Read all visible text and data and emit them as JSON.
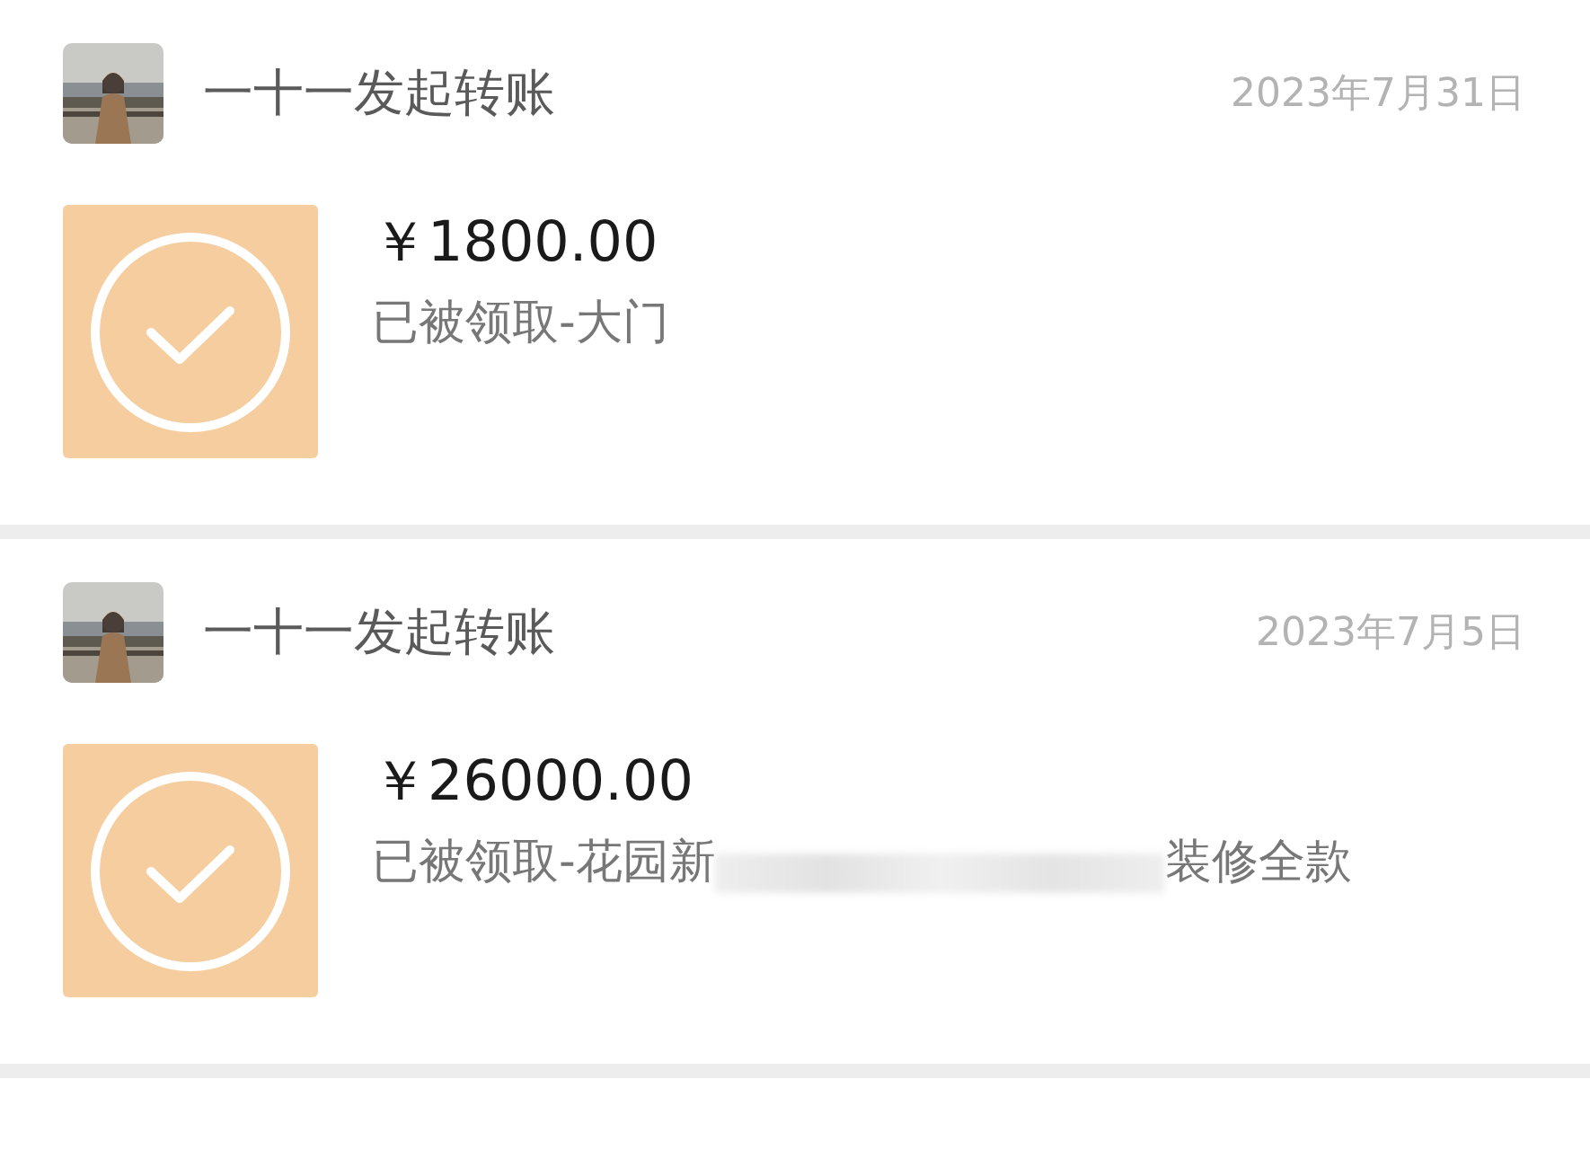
{
  "records": [
    {
      "title": "一十一发起转账",
      "date": "2023年7月31日",
      "amount": "￥1800.00",
      "status_text": "已被领取-大门",
      "redacted": false
    },
    {
      "title": "一十一发起转账",
      "date": "2023年7月5日",
      "amount": "￥26000.00",
      "status_text": "已被领取-花园新",
      "redacted": true,
      "status_tail": "装修全款"
    }
  ]
}
